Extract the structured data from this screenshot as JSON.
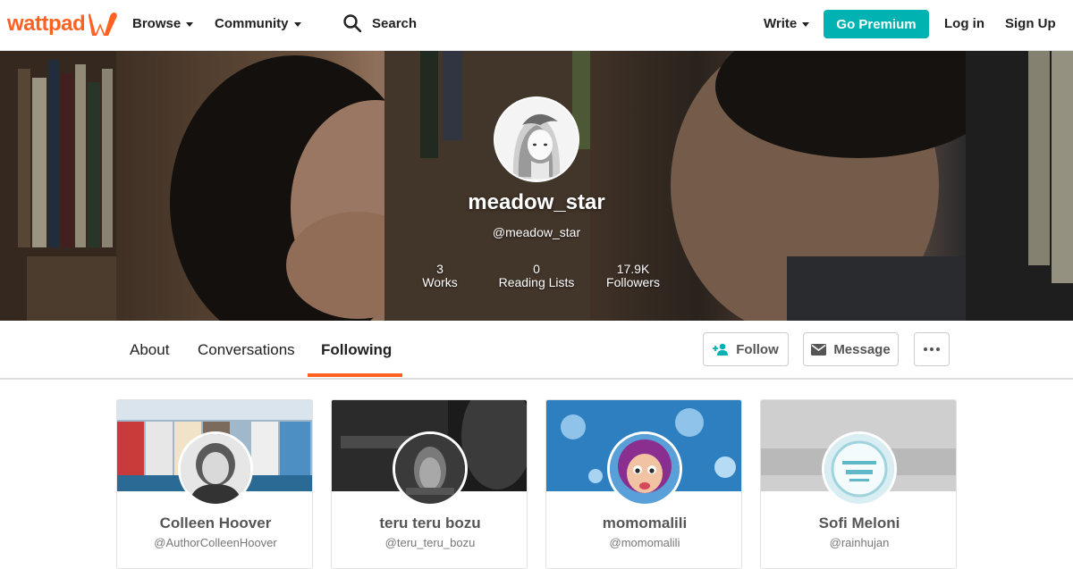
{
  "nav": {
    "logo": "wattpad",
    "browse": "Browse",
    "community": "Community",
    "search": "Search",
    "write": "Write",
    "premium": "Go Premium",
    "login": "Log in",
    "signup": "Sign Up",
    "accent": "#ff6122",
    "premium_color": "#00b2b2"
  },
  "profile": {
    "username": "meadow_star",
    "handle": "@meadow_star",
    "stats": [
      {
        "value": "3",
        "label": "Works"
      },
      {
        "value": "0",
        "label": "Reading Lists"
      },
      {
        "value": "17.9K",
        "label": "Followers"
      }
    ]
  },
  "tabs": {
    "items": [
      "About",
      "Conversations",
      "Following"
    ],
    "active": "Following",
    "follow": "Follow",
    "message": "Message",
    "more_icon": "ellipsis-icon"
  },
  "following": [
    {
      "name": "Colleen Hoover",
      "handle": "@AuthorColleenHoover"
    },
    {
      "name": "teru teru bozu",
      "handle": "@teru_teru_bozu"
    },
    {
      "name": "momomalili",
      "handle": "@momomalili"
    },
    {
      "name": "Sofi Meloni",
      "handle": "@rainhujan"
    }
  ]
}
